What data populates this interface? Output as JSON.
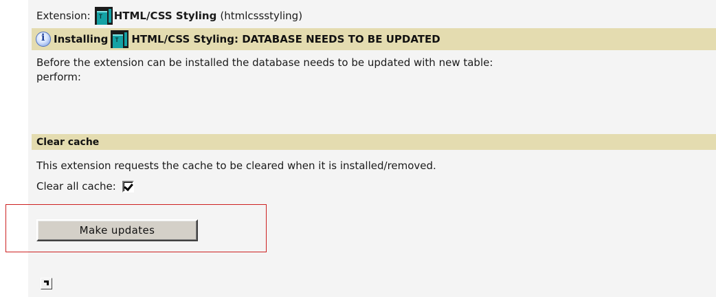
{
  "extension": {
    "label": "Extension:",
    "name": "HTML/CSS Styling",
    "key": "(htmlcssstyling)",
    "icon": "extension-icon"
  },
  "install_header": {
    "prefix": "Installing",
    "text": "HTML/CSS Styling: DATABASE NEEDS TO BE UPDATED",
    "icon": "info-icon"
  },
  "message": {
    "line1": "Before the extension can be installed the database needs to be updated with new table:",
    "line2": "perform:"
  },
  "clear_cache": {
    "section_title": "Clear cache",
    "description": "This extension requests the cache to be cleared when it is installed/removed.",
    "checkbox_label": "Clear all cache:",
    "checked": true
  },
  "actions": {
    "make_updates_label": "Make updates",
    "arrow_icon": "arrow-up-right-icon"
  },
  "colors": {
    "header_bg": "#e4dcb0",
    "highlight_border": "#cc1f1f"
  }
}
